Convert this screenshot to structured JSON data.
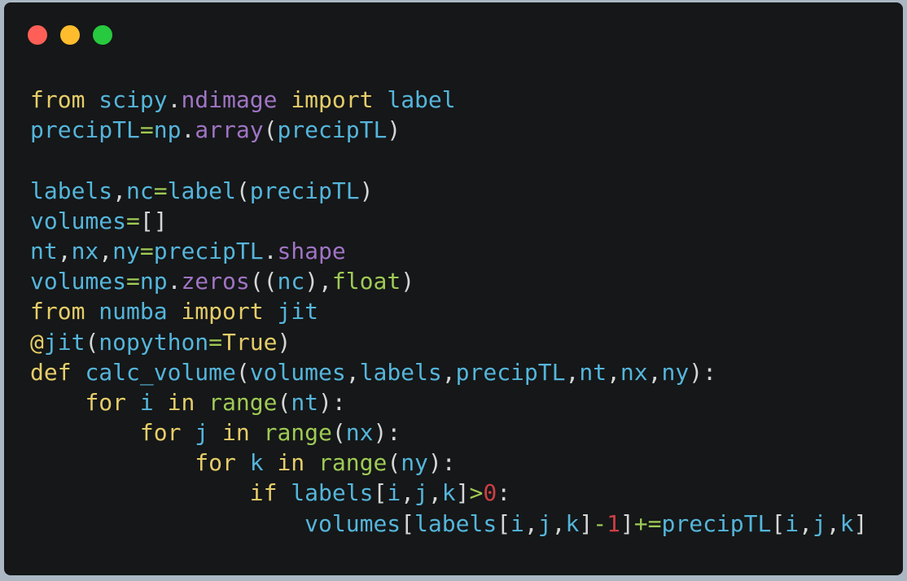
{
  "window": {
    "controls": [
      "close",
      "minimize",
      "maximize"
    ],
    "colors": {
      "close": "#ff5f56",
      "minimize": "#ffbd2e",
      "maximize": "#27c93f",
      "background": "#151718"
    }
  },
  "syntax_colors": {
    "keyword": "#e6cd69",
    "identifier": "#55b5db",
    "attribute": "#a074c4",
    "operator": "#9fca56",
    "number": "#cd3f45",
    "punctuation": "#d4d7d6"
  },
  "code": {
    "language": "python",
    "lines": [
      [
        [
          "kw",
          "from"
        ],
        [
          "pn",
          " "
        ],
        [
          "id",
          "scipy"
        ],
        [
          "pn",
          "."
        ],
        [
          "at",
          "ndimage"
        ],
        [
          "pn",
          " "
        ],
        [
          "kw",
          "import"
        ],
        [
          "pn",
          " "
        ],
        [
          "id",
          "label"
        ]
      ],
      [
        [
          "id",
          "precipTL"
        ],
        [
          "op",
          "="
        ],
        [
          "id",
          "np"
        ],
        [
          "pn",
          "."
        ],
        [
          "at",
          "array"
        ],
        [
          "pn",
          "("
        ],
        [
          "id",
          "precipTL"
        ],
        [
          "pn",
          ")"
        ]
      ],
      [],
      [
        [
          "id",
          "labels"
        ],
        [
          "pn",
          ","
        ],
        [
          "id",
          "nc"
        ],
        [
          "op",
          "="
        ],
        [
          "id",
          "label"
        ],
        [
          "pn",
          "("
        ],
        [
          "id",
          "precipTL"
        ],
        [
          "pn",
          ")"
        ]
      ],
      [
        [
          "id",
          "volumes"
        ],
        [
          "op",
          "="
        ],
        [
          "pn",
          "[]"
        ]
      ],
      [
        [
          "id",
          "nt"
        ],
        [
          "pn",
          ","
        ],
        [
          "id",
          "nx"
        ],
        [
          "pn",
          ","
        ],
        [
          "id",
          "ny"
        ],
        [
          "op",
          "="
        ],
        [
          "id",
          "precipTL"
        ],
        [
          "pn",
          "."
        ],
        [
          "at",
          "shape"
        ]
      ],
      [
        [
          "id",
          "volumes"
        ],
        [
          "op",
          "="
        ],
        [
          "id",
          "np"
        ],
        [
          "pn",
          "."
        ],
        [
          "at",
          "zeros"
        ],
        [
          "pn",
          "(("
        ],
        [
          "id",
          "nc"
        ],
        [
          "pn",
          "),"
        ],
        [
          "bi",
          "float"
        ],
        [
          "pn",
          ")"
        ]
      ],
      [
        [
          "kw",
          "from"
        ],
        [
          "pn",
          " "
        ],
        [
          "id",
          "numba"
        ],
        [
          "pn",
          " "
        ],
        [
          "kw",
          "import"
        ],
        [
          "pn",
          " "
        ],
        [
          "id",
          "jit"
        ]
      ],
      [
        [
          "kw",
          "@"
        ],
        [
          "id",
          "jit"
        ],
        [
          "pn",
          "("
        ],
        [
          "id",
          "nopython"
        ],
        [
          "op",
          "="
        ],
        [
          "kw",
          "True"
        ],
        [
          "pn",
          ")"
        ]
      ],
      [
        [
          "kw",
          "def"
        ],
        [
          "pn",
          " "
        ],
        [
          "id",
          "calc_volume"
        ],
        [
          "pn",
          "("
        ],
        [
          "id",
          "volumes"
        ],
        [
          "pn",
          ","
        ],
        [
          "id",
          "labels"
        ],
        [
          "pn",
          ","
        ],
        [
          "id",
          "precipTL"
        ],
        [
          "pn",
          ","
        ],
        [
          "id",
          "nt"
        ],
        [
          "pn",
          ","
        ],
        [
          "id",
          "nx"
        ],
        [
          "pn",
          ","
        ],
        [
          "id",
          "ny"
        ],
        [
          "pn",
          "):"
        ]
      ],
      [
        [
          "pn",
          "    "
        ],
        [
          "kw",
          "for"
        ],
        [
          "pn",
          " "
        ],
        [
          "id",
          "i"
        ],
        [
          "pn",
          " "
        ],
        [
          "kw",
          "in"
        ],
        [
          "pn",
          " "
        ],
        [
          "bi",
          "range"
        ],
        [
          "pn",
          "("
        ],
        [
          "id",
          "nt"
        ],
        [
          "pn",
          "):"
        ]
      ],
      [
        [
          "pn",
          "        "
        ],
        [
          "kw",
          "for"
        ],
        [
          "pn",
          " "
        ],
        [
          "id",
          "j"
        ],
        [
          "pn",
          " "
        ],
        [
          "kw",
          "in"
        ],
        [
          "pn",
          " "
        ],
        [
          "bi",
          "range"
        ],
        [
          "pn",
          "("
        ],
        [
          "id",
          "nx"
        ],
        [
          "pn",
          "):"
        ]
      ],
      [
        [
          "pn",
          "            "
        ],
        [
          "kw",
          "for"
        ],
        [
          "pn",
          " "
        ],
        [
          "id",
          "k"
        ],
        [
          "pn",
          " "
        ],
        [
          "kw",
          "in"
        ],
        [
          "pn",
          " "
        ],
        [
          "bi",
          "range"
        ],
        [
          "pn",
          "("
        ],
        [
          "id",
          "ny"
        ],
        [
          "pn",
          "):"
        ]
      ],
      [
        [
          "pn",
          "                "
        ],
        [
          "kw",
          "if"
        ],
        [
          "pn",
          " "
        ],
        [
          "id",
          "labels"
        ],
        [
          "pn",
          "["
        ],
        [
          "id",
          "i"
        ],
        [
          "pn",
          ","
        ],
        [
          "id",
          "j"
        ],
        [
          "pn",
          ","
        ],
        [
          "id",
          "k"
        ],
        [
          "pn",
          "]"
        ],
        [
          "op",
          ">"
        ],
        [
          "num",
          "0"
        ],
        [
          "pn",
          ":"
        ]
      ],
      [
        [
          "pn",
          "                    "
        ],
        [
          "id",
          "volumes"
        ],
        [
          "pn",
          "["
        ],
        [
          "id",
          "labels"
        ],
        [
          "pn",
          "["
        ],
        [
          "id",
          "i"
        ],
        [
          "pn",
          ","
        ],
        [
          "id",
          "j"
        ],
        [
          "pn",
          ","
        ],
        [
          "id",
          "k"
        ],
        [
          "pn",
          "]"
        ],
        [
          "op",
          "-"
        ],
        [
          "num",
          "1"
        ],
        [
          "pn",
          "]"
        ],
        [
          "op",
          "+="
        ],
        [
          "id",
          "precipTL"
        ],
        [
          "pn",
          "["
        ],
        [
          "id",
          "i"
        ],
        [
          "pn",
          ","
        ],
        [
          "id",
          "j"
        ],
        [
          "pn",
          ","
        ],
        [
          "id",
          "k"
        ],
        [
          "pn",
          "]"
        ]
      ]
    ]
  }
}
